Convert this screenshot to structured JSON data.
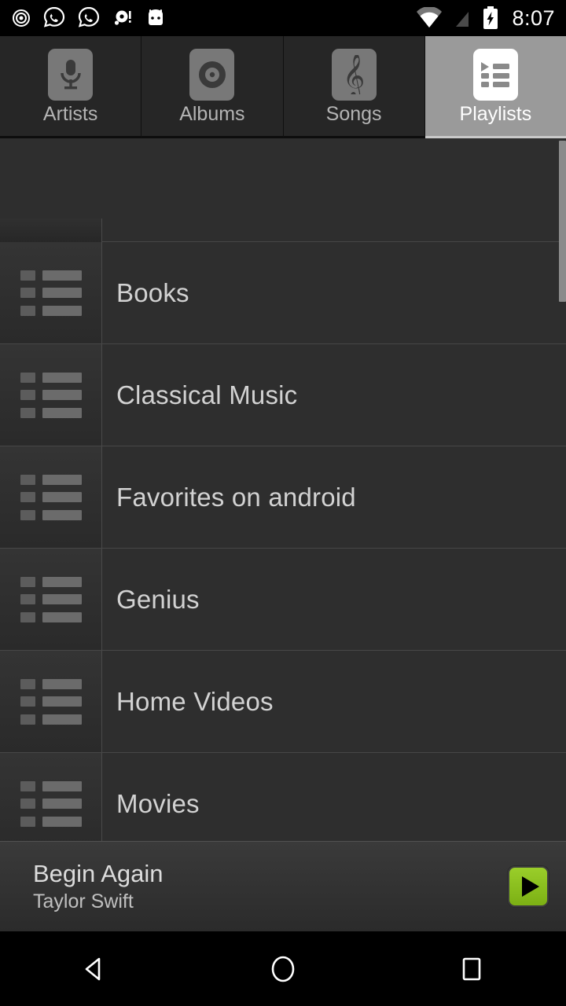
{
  "status_bar": {
    "time": "8:07",
    "notification_icons": [
      "record-circle-icon",
      "whatsapp-icon",
      "whatsapp-icon",
      "alert-circle-icon",
      "android-head-icon"
    ],
    "system_icons": [
      "wifi-icon",
      "no-signal-icon",
      "battery-charging-icon"
    ]
  },
  "tabs": [
    {
      "label": "Artists",
      "icon": "microphone-icon",
      "active": false
    },
    {
      "label": "Albums",
      "icon": "vinyl-disc-icon",
      "active": false
    },
    {
      "label": "Songs",
      "icon": "treble-clef-icon",
      "active": false
    },
    {
      "label": "Playlists",
      "icon": "playlist-icon",
      "active": true
    }
  ],
  "playlists": [
    {
      "name": "Books"
    },
    {
      "name": "Classical Music"
    },
    {
      "name": "Favorites on android"
    },
    {
      "name": "Genius"
    },
    {
      "name": "Home Videos"
    },
    {
      "name": "Movies"
    }
  ],
  "now_playing": {
    "title": "Begin Again",
    "artist": "Taylor Swift",
    "play_button": "play-button",
    "accent_color": "#8BC220"
  },
  "nav_bar": {
    "back": "back-button",
    "home": "home-button",
    "recents": "recents-button"
  },
  "colors": {
    "background": "#2e2e2e",
    "row_divider": "#474747",
    "active_tab": "#9a9a9a",
    "text_primary": "#d2d2d2",
    "accent_green": "#8BC220"
  }
}
